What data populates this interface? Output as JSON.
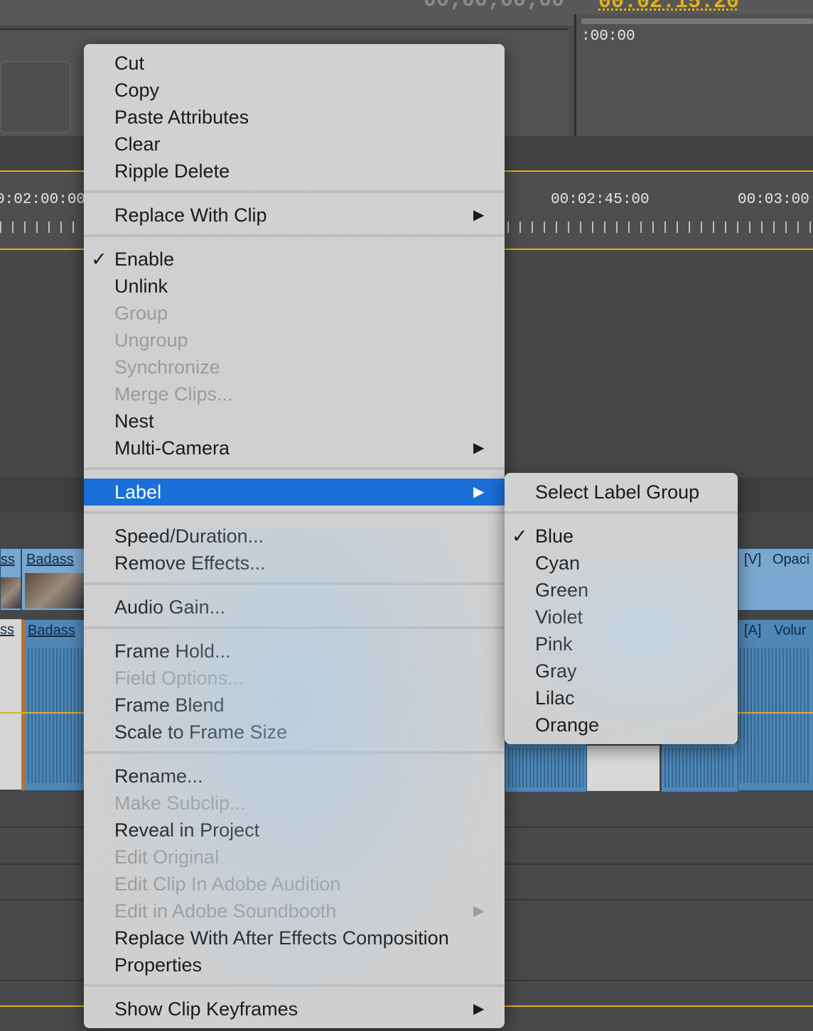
{
  "header": {
    "timecode_gray": "00;00;00;00",
    "timecode_yellow": "00:02:15:20",
    "program_timecode": ":00:00"
  },
  "ruler": {
    "t1": "0:02:00:00",
    "t2": "00:02:45:00",
    "t3": "00:03:00:"
  },
  "clips": {
    "v_left": "ss",
    "v_title": "Badass",
    "v_right_tag": "[V]",
    "v_right_fx": "Opaci",
    "a_left": "ss",
    "a_title": "Badass",
    "a_right_tag": "[A]",
    "a_right_fx": "Volur"
  },
  "context_menu": {
    "items": [
      {
        "label": "Cut"
      },
      {
        "label": "Copy"
      },
      {
        "label": "Paste Attributes"
      },
      {
        "label": "Clear"
      },
      {
        "label": "Ripple Delete"
      },
      {
        "label": "Replace With Clip",
        "submenu": "▶"
      },
      {
        "label": "Enable",
        "check": "✓"
      },
      {
        "label": "Unlink"
      },
      {
        "label": "Group"
      },
      {
        "label": "Ungroup"
      },
      {
        "label": "Synchronize"
      },
      {
        "label": "Merge Clips..."
      },
      {
        "label": "Nest"
      },
      {
        "label": "Multi-Camera",
        "submenu": "▶"
      },
      {
        "label": "Label",
        "submenu": "▶"
      },
      {
        "label": "Speed/Duration..."
      },
      {
        "label": "Remove Effects..."
      },
      {
        "label": "Audio Gain..."
      },
      {
        "label": "Frame Hold..."
      },
      {
        "label": "Field Options..."
      },
      {
        "label": "Frame Blend"
      },
      {
        "label": "Scale to Frame Size"
      },
      {
        "label": "Rename..."
      },
      {
        "label": "Make Subclip..."
      },
      {
        "label": "Reveal in Project"
      },
      {
        "label": "Edit Original"
      },
      {
        "label": "Edit Clip In Adobe Audition"
      },
      {
        "label": "Edit in Adobe Soundbooth",
        "submenu": "▶"
      },
      {
        "label": "Replace With After Effects Composition"
      },
      {
        "label": "Properties"
      },
      {
        "label": "Show Clip Keyframes",
        "submenu": "▶"
      }
    ]
  },
  "label_submenu": {
    "items": [
      {
        "label": "Select Label Group"
      },
      {
        "label": "Blue",
        "check": "✓"
      },
      {
        "label": "Cyan"
      },
      {
        "label": "Green"
      },
      {
        "label": "Violet"
      },
      {
        "label": "Pink"
      },
      {
        "label": "Gray"
      },
      {
        "label": "Lilac"
      },
      {
        "label": "Orange"
      }
    ]
  }
}
